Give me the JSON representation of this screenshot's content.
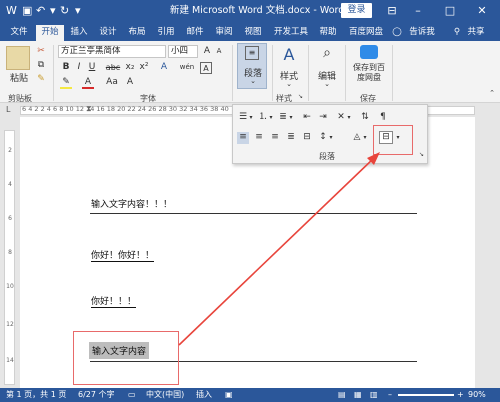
{
  "titlebar": {
    "title": "新建 Microsoft Word 文档.docx - Word",
    "login": "登录",
    "icons": [
      "save-icon",
      "undo-icon",
      "redo-icon",
      "customize-icon"
    ],
    "controls": [
      "ribbon-options-icon",
      "minimize-icon",
      "maximize-icon",
      "close-icon"
    ]
  },
  "tabs": [
    {
      "label": "文件"
    },
    {
      "label": "开始"
    },
    {
      "label": "插入"
    },
    {
      "label": "设计"
    },
    {
      "label": "布局"
    },
    {
      "label": "引用"
    },
    {
      "label": "邮件"
    },
    {
      "label": "审阅"
    },
    {
      "label": "视图"
    },
    {
      "label": "开发工具"
    },
    {
      "label": "帮助"
    },
    {
      "label": "百度网盘"
    },
    {
      "label": "告诉我"
    },
    {
      "label": "共享"
    }
  ],
  "ribbon": {
    "clipboard": {
      "paste": "粘贴",
      "group": "剪贴板"
    },
    "font": {
      "family": "方正兰亭黑简体",
      "size": "小四",
      "group": "字体",
      "bold": "B",
      "italic": "I",
      "underline": "U",
      "strike": "abc",
      "subscript": "x₂",
      "superscript": "x²",
      "font_color_glyph": "A",
      "change_case": "Aa",
      "grow": "A",
      "shrink": "A",
      "wen": "wén",
      "char_border": "A"
    },
    "paragraph": {
      "label": "段落",
      "group": "段落"
    },
    "styles": {
      "label": "样式",
      "group": "样式"
    },
    "editing": {
      "label": "编辑"
    },
    "baidu": {
      "label": "保存到百度网盘",
      "group": "保存"
    }
  },
  "ruler_numbers": "6  4  2     2  4  6  8  10  12  14  16  18  20  22  24  26  28  30  32  34  36  38  40",
  "vruler_numbers": [
    "2",
    "4",
    "6",
    "8",
    "10",
    "12",
    "14"
  ],
  "document": {
    "lines": [
      "输入文字内容！！！",
      "你好！你好！！",
      "你好！！！",
      "输入文字内容"
    ]
  },
  "paragraph_panel": {
    "group_label": "段落"
  },
  "statusbar": {
    "page": "第 1 页，共 1 页",
    "words": "6/27 个字",
    "language": "中文(中国)",
    "mode": "插入",
    "zoom": "90%"
  },
  "colors": {
    "brand": "#2b579a",
    "annotation": "#e8453c"
  }
}
